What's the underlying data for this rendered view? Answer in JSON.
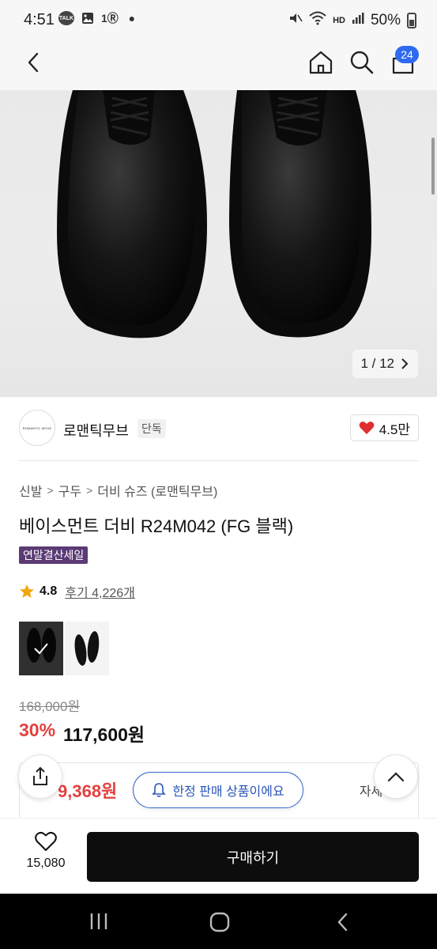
{
  "status_bar": {
    "time": "4:51",
    "talk_badge": "TALK",
    "lte_label": "1Ⓡ",
    "hd_label": "HD",
    "battery": "50%"
  },
  "header": {
    "cart_count": "24"
  },
  "gallery": {
    "counter": "1 / 12"
  },
  "brand": {
    "logo_text": "ROMANTIC MOVE",
    "name": "로맨틱무브",
    "tag": "단독",
    "likes": "4.5만"
  },
  "breadcrumb": [
    "신발",
    "구두",
    "더비 슈즈 (로맨틱무브)"
  ],
  "product": {
    "title": "베이스먼트 더비 R24M042 (FG 블랙)",
    "sale_badge": "연말결산세일",
    "rating": "4.8",
    "reviews": "후기 4,226개",
    "original_price": "168,000원",
    "discount": "30%",
    "sale_price": "117,600원"
  },
  "benefit": {
    "price": "9,368원",
    "limited_label": "한정 판매 상품이에요",
    "detail_label": "자세히"
  },
  "bottom_bar": {
    "wish_count": "15,080",
    "buy_label": "구매하기"
  },
  "colors": {
    "accent_red": "#e34040",
    "badge_purple": "#5b3a75",
    "cart_blue": "#2e6bf0",
    "pill_blue": "#3366cc"
  }
}
